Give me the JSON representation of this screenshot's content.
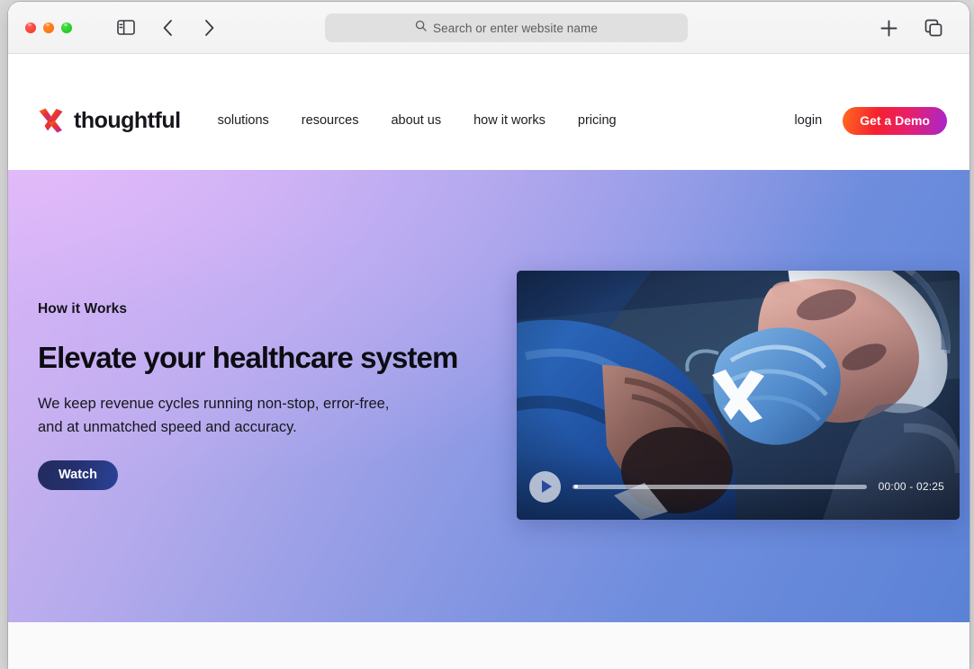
{
  "browser": {
    "traffic_lights": [
      {
        "name": "close",
        "color": "#f4332a"
      },
      {
        "name": "minimize",
        "color": "#fb6a06"
      },
      {
        "name": "zoom",
        "color": "#13c313"
      }
    ],
    "toolbar": {
      "sidebar_icon": "sidebar-toggle-icon",
      "back_icon": "chevron-left-icon",
      "forward_icon": "chevron-right-icon",
      "new_tab_icon": "plus-icon",
      "tab_overview_icon": "copy-tabs-icon",
      "search_icon": "search-icon",
      "address_placeholder": "Search or enter website name",
      "address_value": ""
    }
  },
  "site": {
    "brand": {
      "name": "thoughtful",
      "logo_icon": "thoughtful-x-logo",
      "gradient_from": "#f5741f",
      "gradient_to": "#a627cf"
    },
    "nav": [
      {
        "label": "solutions"
      },
      {
        "label": "resources"
      },
      {
        "label": "about us"
      },
      {
        "label": "how it works"
      },
      {
        "label": "pricing"
      }
    ],
    "header_actions": {
      "login_label": "login",
      "demo_label": "Get a Demo",
      "demo_gradient_from": "#ff6a1f",
      "demo_gradient_to": "#a627cf"
    },
    "hero": {
      "eyebrow": "How it Works",
      "title": "Elevate your healthcare system",
      "subtitle": "We keep revenue cycles running non-stop, error-free, and at unmatched speed and accuracy.",
      "cta_label": "Watch",
      "cta_color": "#232b5e",
      "bg_from": "#d9b6f3",
      "bg_to": "#5b82d6"
    },
    "video": {
      "alt": "surgeon in blue scrubs and mask performing a procedure",
      "watermark_icon": "thoughtful-x-watermark",
      "play_icon": "play-icon",
      "time_label": "00:00 - 02:25",
      "progress_percent": 0
    }
  }
}
